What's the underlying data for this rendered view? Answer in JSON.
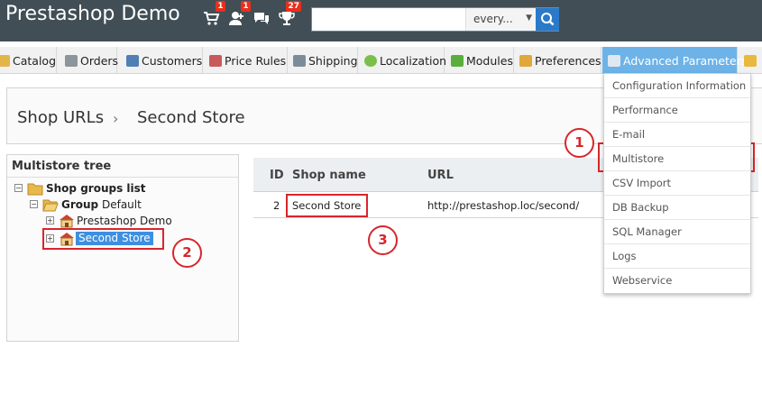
{
  "header": {
    "title": "Prestashop Demo",
    "badges": {
      "orders": "1",
      "customers": "1",
      "notifications": "27"
    },
    "search": {
      "value": "",
      "scope": "every..."
    }
  },
  "tabs": [
    {
      "label": "Catalog"
    },
    {
      "label": "Orders"
    },
    {
      "label": "Customers"
    },
    {
      "label": "Price Rules"
    },
    {
      "label": "Shipping"
    },
    {
      "label": "Localization"
    },
    {
      "label": "Modules"
    },
    {
      "label": "Preferences"
    },
    {
      "label": "Advanced Parameters"
    }
  ],
  "submenu": [
    {
      "label": "Configuration Information"
    },
    {
      "label": "Performance"
    },
    {
      "label": "E-mail"
    },
    {
      "label": "Multistore"
    },
    {
      "label": "CSV Import"
    },
    {
      "label": "DB Backup"
    },
    {
      "label": "SQL Manager"
    },
    {
      "label": "Logs"
    },
    {
      "label": "Webservice"
    }
  ],
  "breadcrumb": {
    "parent": "Shop URLs",
    "current": "Second Store"
  },
  "tree": {
    "title": "Multistore tree",
    "root": "Shop groups list",
    "group_prefix": "Group",
    "group_name": "Default",
    "shops": [
      "Prestashop Demo",
      "Second Store"
    ]
  },
  "table": {
    "headers": {
      "id": "ID",
      "shop_name": "Shop name",
      "url": "URL"
    },
    "rows": [
      {
        "id": "2",
        "shop_name": "Second Store",
        "url": "http://prestashop.loc/second/"
      }
    ]
  },
  "annotations": [
    "1",
    "2",
    "3"
  ],
  "colors": {
    "header_bg": "#414e55",
    "active_tab": "#6db3e8",
    "annotation_red": "#d7262c",
    "selected_node": "#3d8fe0"
  }
}
